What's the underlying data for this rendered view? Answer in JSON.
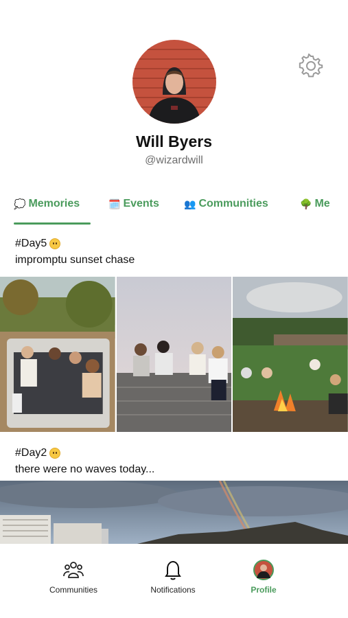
{
  "profile": {
    "name": "Will Byers",
    "handle": "@wizardwill"
  },
  "icons": {
    "settings": "gear-icon",
    "communities": "people-icon",
    "notifications": "bell-icon"
  },
  "tabs": [
    {
      "emoji": "💭",
      "label": "Memories"
    },
    {
      "emoji": "🗓️",
      "label": "Events"
    },
    {
      "emoji": "👥",
      "label": "Communities"
    },
    {
      "emoji": "🌳",
      "label": "Me"
    }
  ],
  "posts": [
    {
      "title": "#Day5",
      "caption": "impromptu sunset chase"
    },
    {
      "title": "#Day2",
      "caption": "there were no waves today..."
    }
  ],
  "bottom_nav": [
    {
      "label": "Communities"
    },
    {
      "label": "Notifications"
    },
    {
      "label": "Profile"
    }
  ],
  "colors": {
    "accent": "#4a9b5c",
    "text": "#111111",
    "muted": "#6d6d6d"
  }
}
